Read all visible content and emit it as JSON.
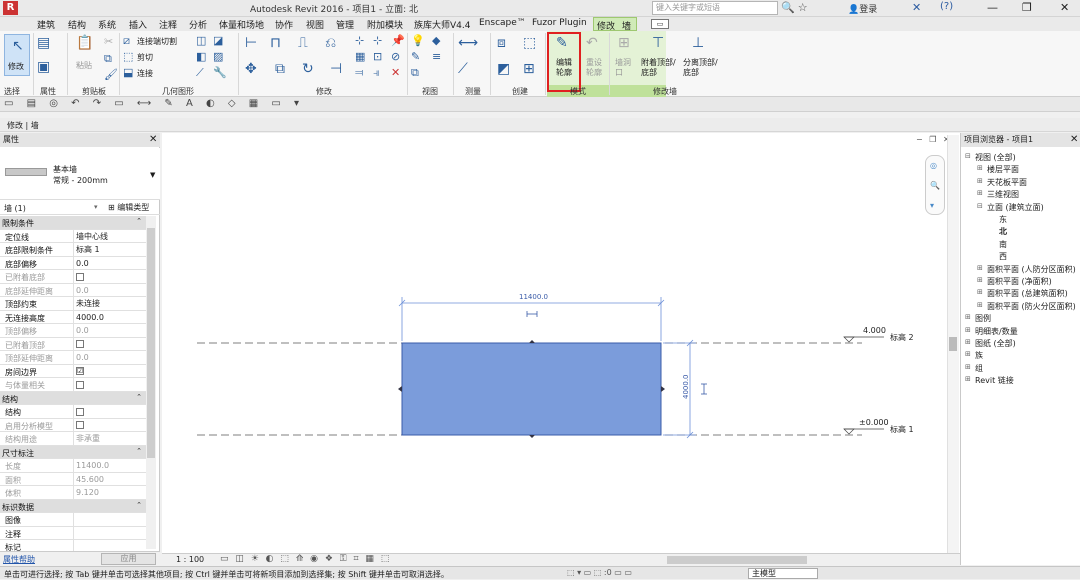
{
  "titlebar": {
    "app_letter": "R",
    "title": "Autodesk Revit 2016 -    项目1 - 立面: 北",
    "search_placeholder": "键入关键字或短语",
    "login": "登录",
    "help": "?"
  },
  "tabs": [
    "建筑",
    "结构",
    "系统",
    "插入",
    "注释",
    "分析",
    "体量和场地",
    "协作",
    "视图",
    "管理",
    "附加模块",
    "族库大师V4.4",
    "Enscape™",
    "Fuzor Plugin",
    "修改",
    "墙"
  ],
  "ribbon": {
    "modify_label": "修改",
    "groups": [
      "选择",
      "属性",
      "剪贴板",
      "几何图形",
      "修改",
      "视图",
      "测量",
      "创建",
      "模式",
      "修改墙"
    ],
    "paste_label": "粘贴",
    "cut_join": "连接端切割",
    "cut": "剪切",
    "join": "连接",
    "edit_profile": "编辑轮廓",
    "reset_profile": "重设轮廓",
    "wall_opening": "墙洞口",
    "attach": "附着顶部/底部",
    "detach": "分离顶部/底部"
  },
  "option_bar": {
    "text": "修改 | 墙"
  },
  "properties": {
    "header": "属性",
    "type_name": "基本墙",
    "type_sub": "常规 - 200mm",
    "filter": "墙 (1)",
    "edit_type": "编辑类型",
    "rows": [
      {
        "k": "限制条件",
        "v": "",
        "cat": true
      },
      {
        "k": "定位线",
        "v": "墙中心线"
      },
      {
        "k": "底部限制条件",
        "v": "标高 1"
      },
      {
        "k": "底部偏移",
        "v": "0.0"
      },
      {
        "k": "已附着底部",
        "v": "",
        "dim": true,
        "cb": true
      },
      {
        "k": "底部延伸距离",
        "v": "0.0",
        "dim": true
      },
      {
        "k": "顶部约束",
        "v": "未连接"
      },
      {
        "k": "无连接高度",
        "v": "4000.0"
      },
      {
        "k": "顶部偏移",
        "v": "0.0",
        "dim": true
      },
      {
        "k": "已附着顶部",
        "v": "",
        "dim": true,
        "cb": true
      },
      {
        "k": "顶部延伸距离",
        "v": "0.0",
        "dim": true
      },
      {
        "k": "房间边界",
        "v": "☑",
        "cb": true
      },
      {
        "k": "与体量相关",
        "v": "",
        "dim": true,
        "cb": true
      },
      {
        "k": "结构",
        "v": "",
        "cat": true
      },
      {
        "k": "结构",
        "v": "",
        "cb": true
      },
      {
        "k": "启用分析模型",
        "v": "",
        "dim": true,
        "cb": true
      },
      {
        "k": "结构用途",
        "v": "非承重",
        "dim": true
      },
      {
        "k": "尺寸标注",
        "v": "",
        "cat": true
      },
      {
        "k": "长度",
        "v": "11400.0",
        "dim": true
      },
      {
        "k": "面积",
        "v": "45.600",
        "dim": true
      },
      {
        "k": "体积",
        "v": "9.120",
        "dim": true
      },
      {
        "k": "标识数据",
        "v": "",
        "cat": true
      },
      {
        "k": "图像",
        "v": ""
      },
      {
        "k": "注释",
        "v": ""
      },
      {
        "k": "标记",
        "v": ""
      }
    ],
    "help_link": "属性帮助",
    "apply": "应用"
  },
  "canvas": {
    "dim_width": "11400.0",
    "dim_height": "4000.0",
    "level2_value": "4.000",
    "level2_name": "标高 2",
    "level1_value": "±0.000",
    "level1_name": "标高 1",
    "wall_color": "#7b9cdb"
  },
  "viewbar": {
    "scale": "1 : 100"
  },
  "browser": {
    "header": "项目浏览器 - 项目1",
    "items": [
      {
        "t": "视图 (全部)",
        "indent": 0
      },
      {
        "t": "楼层平面",
        "indent": 1
      },
      {
        "t": "天花板平面",
        "indent": 1
      },
      {
        "t": "三维视图",
        "indent": 1
      },
      {
        "t": "立面 (建筑立面)",
        "indent": 1
      },
      {
        "t": "东",
        "indent": 2
      },
      {
        "t": "北",
        "indent": 2
      },
      {
        "t": "南",
        "indent": 2
      },
      {
        "t": "西",
        "indent": 2
      },
      {
        "t": "面积平面 (人防分区面积)",
        "indent": 1
      },
      {
        "t": "面积平面 (净面积)",
        "indent": 1
      },
      {
        "t": "面积平面 (总建筑面积)",
        "indent": 1
      },
      {
        "t": "面积平面 (防火分区面积)",
        "indent": 1
      },
      {
        "t": "图例",
        "indent": 0
      },
      {
        "t": "明细表/数量",
        "indent": 0
      },
      {
        "t": "图纸 (全部)",
        "indent": 0
      },
      {
        "t": "族",
        "indent": 0
      },
      {
        "t": "组",
        "indent": 0
      },
      {
        "t": "Revit 链接",
        "indent": 0
      }
    ]
  },
  "status": {
    "text": "单击可进行选择; 按 Tab 键并单击可选择其他项目; 按 Ctrl 键并单击可将新项目添加到选择集; 按 Shift 键并单击可取消选择。",
    "zero": ":0",
    "main_model": "主模型"
  }
}
